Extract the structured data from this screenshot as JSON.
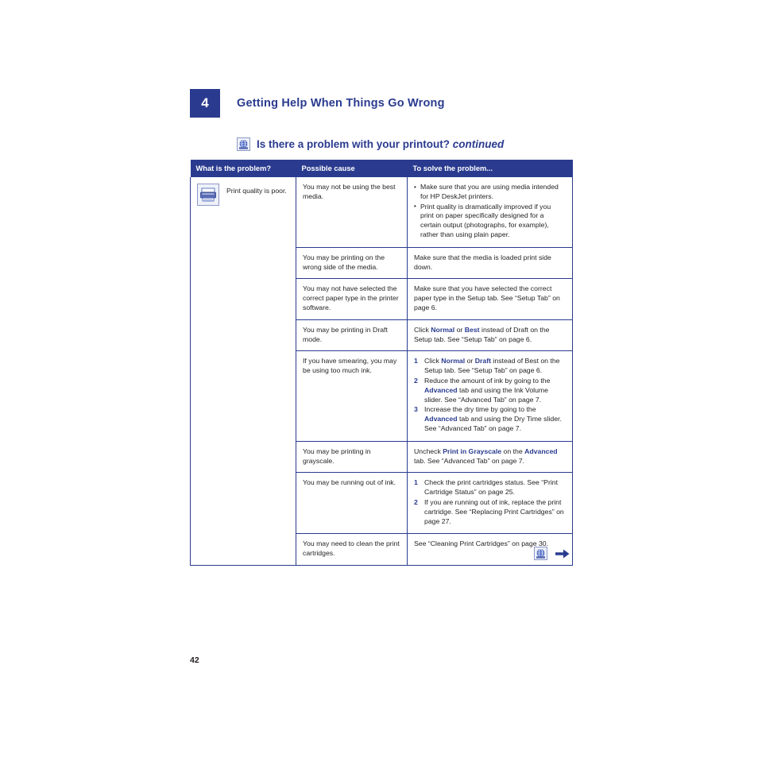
{
  "chapter": {
    "number": "4",
    "title": "Getting Help When Things Go Wrong"
  },
  "section": {
    "title": "Is there a problem with your printout?",
    "continued": "continued",
    "icon": "printer-globe-icon"
  },
  "table": {
    "headers": [
      "What is the problem?",
      "Possible cause",
      "To solve the problem..."
    ],
    "problem_label": "Print quality is poor.",
    "problem_icon": "printer-icon",
    "rows": [
      {
        "cause": "You may not be using the best media.",
        "solution_bullets": [
          "Make sure that you are using media intended for HP DeskJet printers.",
          "Print quality is dramatically improved if you print on paper specifically designed for a certain output (photographs, for example), rather than using plain paper."
        ]
      },
      {
        "cause": "You may be printing on the wrong side of the media.",
        "solution_text": "Make sure that the media is loaded print side down."
      },
      {
        "cause": "You may not have selected the correct paper type in the printer software.",
        "solution_text": "Make sure that you have selected the correct paper type in the Setup tab. See “Setup Tab” on page 6."
      },
      {
        "cause": "You may be printing in Draft mode.",
        "solution_rich": {
          "pre": "Click ",
          "kw1": "Normal",
          "mid": " or ",
          "kw2": "Best",
          "post": " instead of Draft on the Setup tab. See “Setup Tab” on page 6."
        }
      },
      {
        "cause": "If you have smearing, you may be using too much ink.",
        "steps": [
          {
            "num": "1",
            "pre": "Click ",
            "kw1": "Normal",
            "mid": " or ",
            "kw2": "Draft",
            "post": " instead of Best on the Setup tab. See “Setup Tab” on page 6."
          },
          {
            "num": "2",
            "pre": "Reduce the amount of ink by going to the ",
            "kw1": "Advanced",
            "post": " tab and using the Ink Volume slider. See “Advanced Tab” on page 7."
          },
          {
            "num": "3",
            "pre": "Increase the dry time by going to the ",
            "kw1": "Advanced",
            "post": " tab and using the Dry Time slider. See “Advanced Tab” on page 7."
          }
        ]
      },
      {
        "cause": "You may be printing in grayscale.",
        "solution_rich": {
          "pre": "Uncheck ",
          "kw1": "Print in Grayscale",
          "mid": " on the ",
          "kw2": "Advanced",
          "post": " tab. See “Advanced Tab” on page 7."
        }
      },
      {
        "cause": "You may be running out of ink.",
        "steps": [
          {
            "num": "1",
            "pre": "Check the print cartridges status. See “Print Cartridge Status” on page 25."
          },
          {
            "num": "2",
            "pre": "If you are running out of ink, replace the print cartridge. See “Replacing Print Cartridges” on page 27."
          }
        ]
      },
      {
        "cause": "You may need to clean the print cartridges.",
        "solution_text": "See “Cleaning Print Cartridges” on page 30."
      }
    ]
  },
  "footer": {
    "nav_icon": "printer-globe-icon",
    "arrow_icon": "right-arrow-icon",
    "page_number": "42"
  },
  "colors": {
    "brand_blue": "#2a3b8f",
    "text": "#231f20",
    "header_bg": "#2a3b8f"
  }
}
